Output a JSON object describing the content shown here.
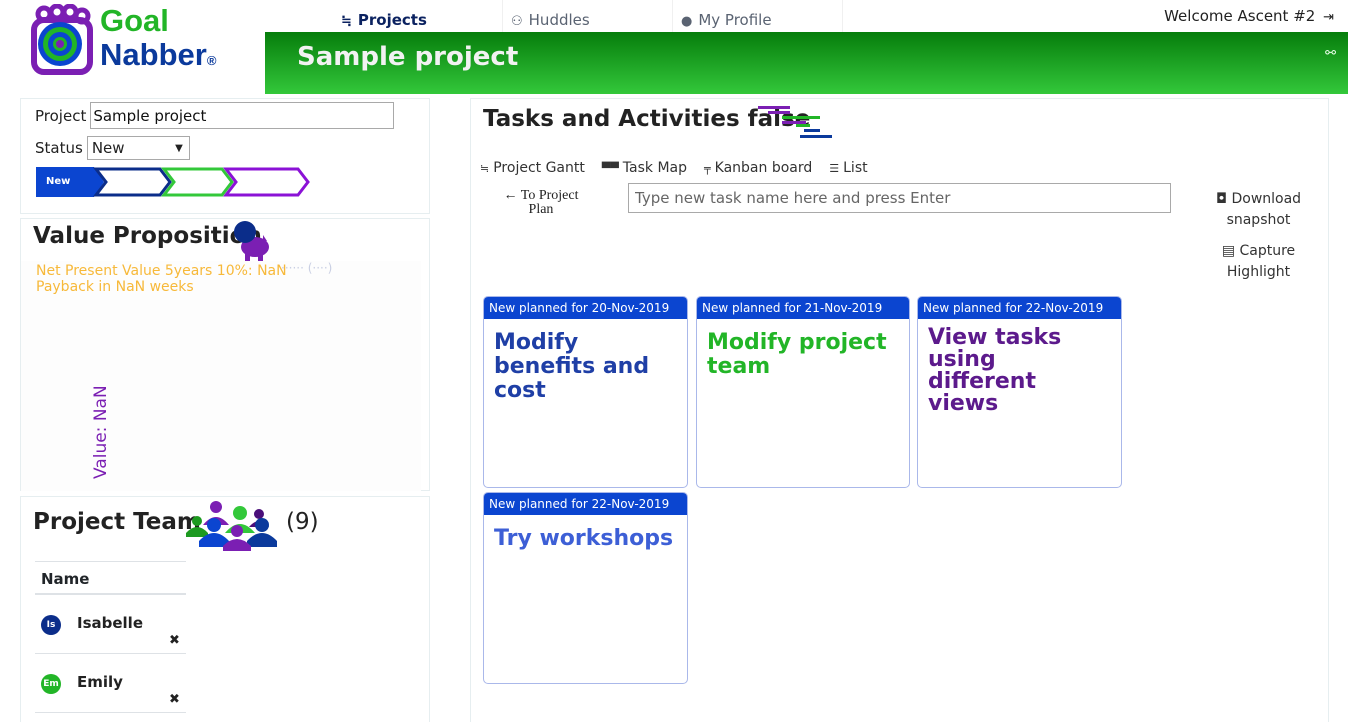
{
  "logo": {
    "line1": "Goal",
    "line2": "Nabber",
    "registered": "®"
  },
  "topnav": {
    "items": [
      {
        "label": "Projects",
        "icon": "gantt-steps-icon",
        "glyph": "≒",
        "active": true
      },
      {
        "label": "Huddles",
        "icon": "people-icon",
        "glyph": "⚇",
        "active": false
      },
      {
        "label": "My Profile",
        "icon": "user-circle-icon",
        "glyph": "●",
        "active": false
      }
    ],
    "welcome": "Welcome Ascent #2",
    "logout_glyph": "⇥"
  },
  "banner": {
    "title": "Sample project",
    "icon_glyph": "⚯"
  },
  "project_panel": {
    "project_label": "Project",
    "project_value": "Sample project",
    "status_label": "Status",
    "status_value": "New",
    "stages": [
      {
        "label": "New",
        "color": "#0b45d0",
        "filled": true
      },
      {
        "label": "",
        "color": "#0b2d8a",
        "filled": false
      },
      {
        "label": "",
        "color": "#33c83a",
        "filled": false
      },
      {
        "label": "",
        "color": "#8b12d6",
        "filled": false
      }
    ]
  },
  "value_proposition": {
    "title": "Value Proposition",
    "npv_line": "Net Present Value 5years 10%: NaN",
    "payback_line": "Payback in NaN weeks",
    "overlapping_label": "······ (····)",
    "axis_label": "Value: NaN"
  },
  "team": {
    "title": "Project Team",
    "count": "(9)",
    "column_header": "Name",
    "members": [
      {
        "initials": "Is",
        "name": "Isabelle",
        "color": "#0b2d8a",
        "remove": "✖"
      },
      {
        "initials": "Em",
        "name": "Emily",
        "color": "#22b527",
        "remove": "✖"
      }
    ]
  },
  "main": {
    "title": "Tasks and Activities false",
    "views": [
      {
        "label": "Project Gantt",
        "glyph": "≒",
        "icon": "gantt-icon"
      },
      {
        "label": "Task Map",
        "glyph": "▀▀",
        "icon": "task-map-icon"
      },
      {
        "label": "Kanban board",
        "glyph": "╤",
        "icon": "kanban-icon"
      },
      {
        "label": "List",
        "glyph": "☰",
        "icon": "list-icon"
      }
    ],
    "back_link": "← To Project Plan",
    "task_input_placeholder": "Type new task name here and press Enter",
    "task_input_value": "",
    "actions": [
      {
        "label": "Download snapshot",
        "glyph": "📷",
        "icon": "camera-icon"
      },
      {
        "label": "Capture Highlight",
        "glyph": "▤",
        "icon": "capture-icon"
      }
    ],
    "cards": [
      {
        "header": "New planned for 20-Nov-2019",
        "title": "Modify benefits and cost",
        "color": "#1f3fa6"
      },
      {
        "header": "New planned for 21-Nov-2019",
        "title": "Modify project team",
        "color": "#22b527"
      },
      {
        "header": "New planned for 22-Nov-2019",
        "title": "View tasks using different views",
        "color": "#5c1a8c"
      },
      {
        "header": "New planned for 22-Nov-2019",
        "title": "Try workshops",
        "color": "#3d5fd6"
      }
    ]
  }
}
